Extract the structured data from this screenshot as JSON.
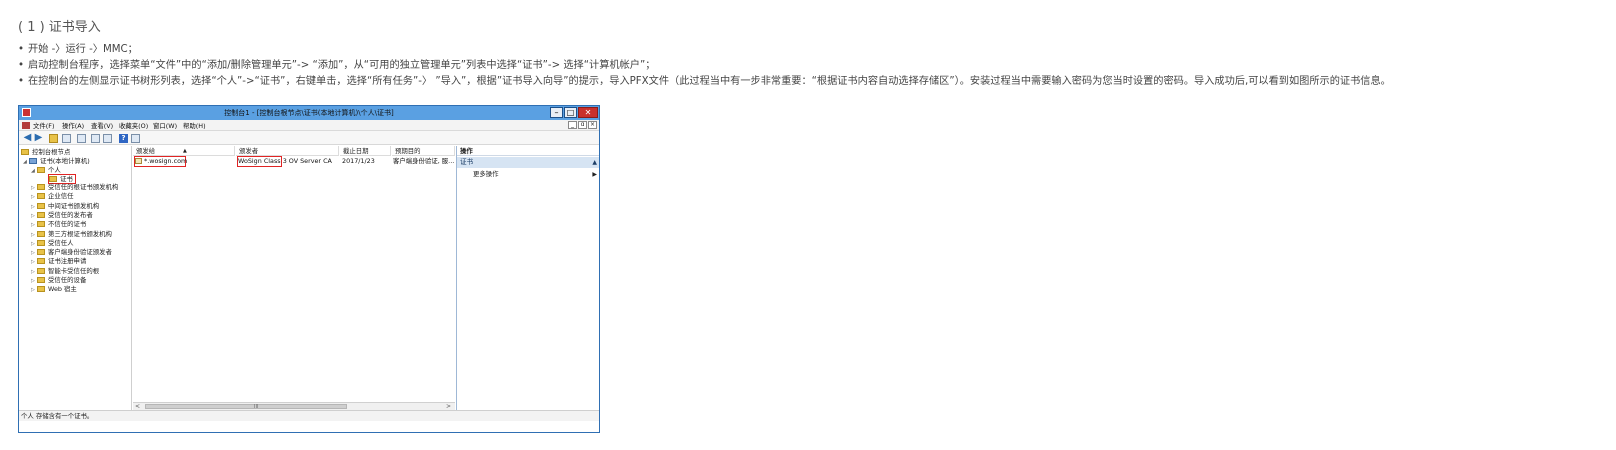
{
  "doc": {
    "heading": "( 1 ) 证书导入",
    "steps": [
      "开始 -〉运行 -〉MMC；",
      "启动控制台程序，选择菜单“文件”中的“添加/删除管理单元”-> “添加”，从“可用的独立管理单元”列表中选择“证书”-> 选择“计算机帐户”；",
      "在控制台的左侧显示证书树形列表，选择“个人”->“证书”，右键单击，选择“所有任务”-〉 ”导入”，根据”证书导入向导”的提示，导入PFX文件（此过程当中有一步非常重要：“根据证书内容自动选择存储区”）。安装过程当中需要输入密码为您当时设置的密码。导入成功后,可以看到如图所示的证书信息。"
    ],
    "bullet": "•"
  },
  "window": {
    "title": "控制台1 - [控制台根节点\\证书(本地计算机)\\个人\\证书]",
    "controls": {
      "minimize": "–",
      "maximize": "□",
      "close": "✕"
    },
    "menu": [
      "文件(F)",
      "操作(A)",
      "查看(V)",
      "收藏夹(O)",
      "窗口(W)",
      "帮助(H)"
    ],
    "mdi_controls": [
      "_",
      "ɑ",
      "×"
    ],
    "toolbar_icons": [
      "back-arrow-icon",
      "forward-arrow-icon",
      "folder-icon",
      "console-tree-icon",
      "copy-icon",
      "export-icon",
      "properties-icon",
      "help-icon",
      "view-icon"
    ],
    "tree": {
      "root": "控制台根节点",
      "computer": "证书(本地计算机)",
      "personal": "个人",
      "certs": "证书",
      "stores": [
        "受信任的根证书颁发机构",
        "企业信任",
        "中间证书颁发机构",
        "受信任的发布者",
        "不信任的证书",
        "第三方根证书颁发机构",
        "受信任人",
        "客户端身份验证颁发者",
        "证书注册申请",
        "智能卡受信任的根",
        "受信任的设备",
        "Web 宿主"
      ]
    },
    "list": {
      "columns": [
        "颁发给",
        "颁发者",
        "截止日期",
        "预期目的"
      ],
      "sort_indicator": "▲",
      "rows": [
        {
          "issued_to": "*.wosign.com",
          "issuer": "WoSign Class 3 OV Server CA",
          "issuer_boxed": "WoSign Class",
          "issuer_rest": "3 OV Server CA",
          "expires": "2017/1/23",
          "purpose": "客户端身份验证, 服..."
        }
      ],
      "scroll_left": "<",
      "scroll_right": ">",
      "scroll_grip": "III"
    },
    "actions": {
      "header": "操作",
      "section": "证书",
      "section_arrow": "▲",
      "item": "更多操作",
      "item_arrow": "▶"
    },
    "status": "个人 存储含有一个证书。"
  }
}
